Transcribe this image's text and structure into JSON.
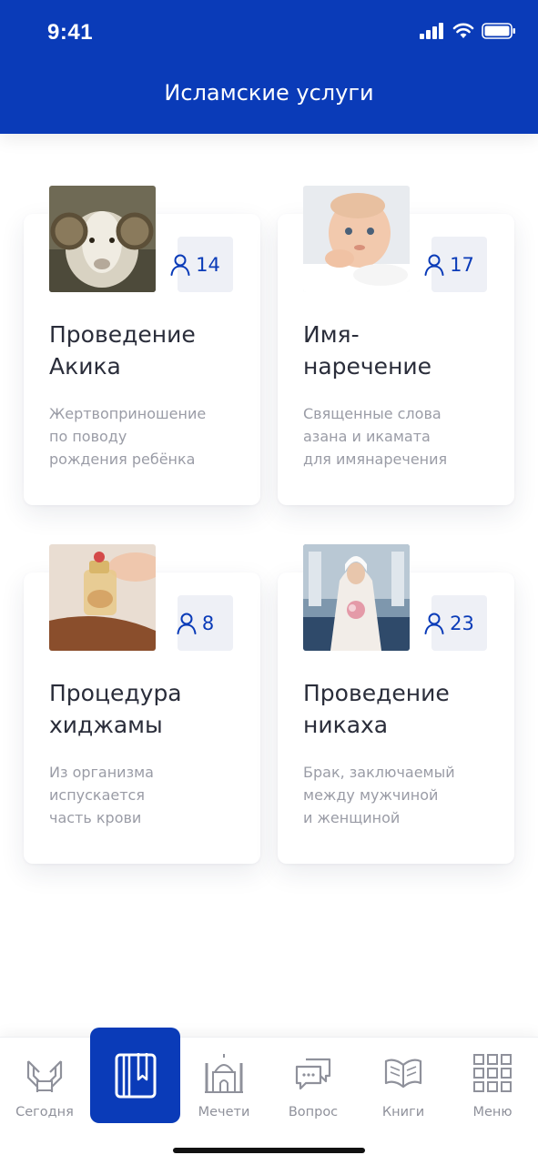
{
  "status_bar": {
    "time": "9:41"
  },
  "header": {
    "title": "Исламские услуги"
  },
  "colors": {
    "brand": "#0a3bb8",
    "badge_bg": "#eef0f6",
    "muted_text": "#9a9ca6"
  },
  "cards": [
    {
      "title_line1": "Проведение",
      "title_line2": "Акика",
      "count": "14",
      "desc_line1": "Жертвоприношение",
      "desc_line2": "по поводу",
      "desc_line3": "рождения ребёнка",
      "image": "ram-photo"
    },
    {
      "title_line1": "Имя-",
      "title_line2": "наречение",
      "count": "17",
      "desc_line1": "Священные слова",
      "desc_line2": "азана и икамата",
      "desc_line3": "для имянаречения",
      "image": "baby-photo"
    },
    {
      "title_line1": "Процедура",
      "title_line2": "хиджамы",
      "count": "8",
      "desc_line1": "Из организма",
      "desc_line2": "испускается",
      "desc_line3": "часть крови",
      "image": "cupping-photo"
    },
    {
      "title_line1": "Проведение",
      "title_line2": "никаха",
      "count": "23",
      "desc_line1": "Брак, заключаемый",
      "desc_line2": "между мужчиной",
      "desc_line3": "и женщиной",
      "image": "bride-photo"
    }
  ],
  "tabbar": {
    "items": [
      {
        "label": "Сегодня",
        "icon": "hands-icon"
      },
      {
        "label": "",
        "icon": "quran-book-icon",
        "active": true
      },
      {
        "label": "Мечети",
        "icon": "mosque-icon"
      },
      {
        "label": "Вопрос",
        "icon": "chat-icon"
      },
      {
        "label": "Книги",
        "icon": "open-book-icon"
      },
      {
        "label": "Меню",
        "icon": "grid-icon"
      }
    ]
  }
}
